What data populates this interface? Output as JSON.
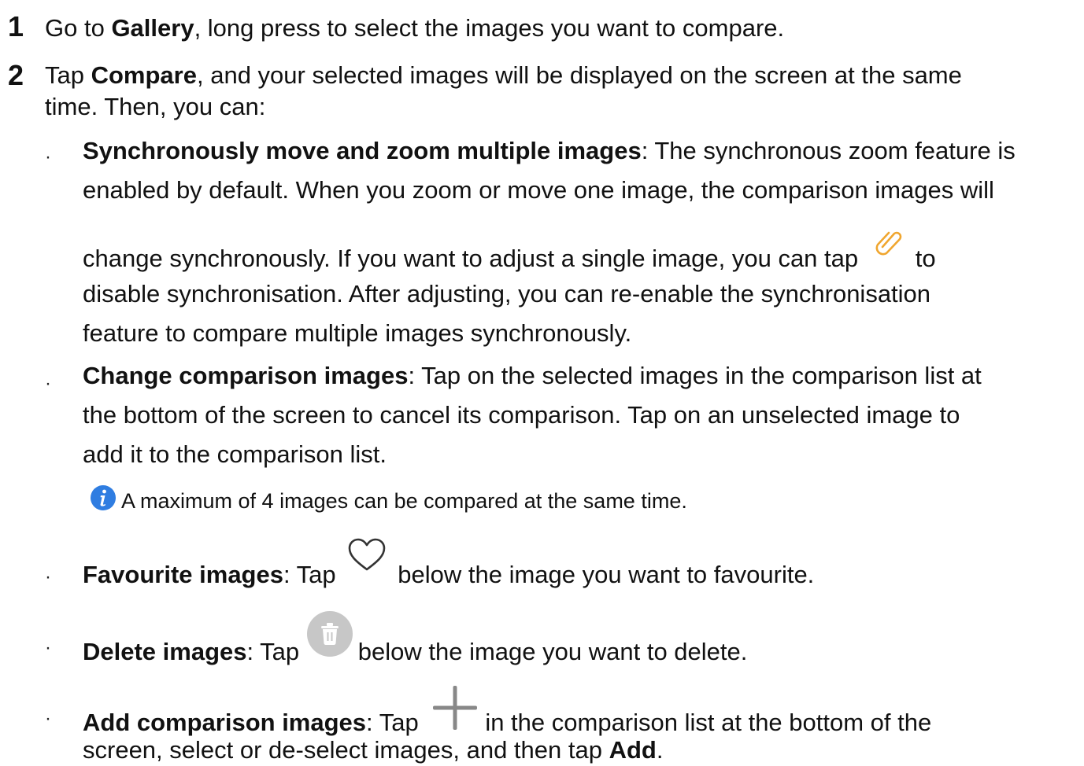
{
  "steps": [
    {
      "num": "1",
      "pre": "Go to ",
      "bold": "Gallery",
      "post": ", long press to select the images you want to compare."
    },
    {
      "num": "2",
      "pre": "Tap ",
      "bold": "Compare",
      "post": ", and your selected images will be displayed on the screen at the same",
      "line2": "time. Then, you can:"
    }
  ],
  "bullets": {
    "sync": {
      "title": "Synchronously move and zoom multiple images",
      "line1_rest": ": The synchronous zoom feature is",
      "line2": "enabled by default. When you zoom or move one image, the comparison images will",
      "line3_pre": "change synchronously. If you want to adjust a single image, you can tap",
      "line3_post": "to",
      "line4": "disable synchronisation. After adjusting, you can re-enable the synchronisation",
      "line5": "feature to compare multiple images synchronously.",
      "icon": "link-icon"
    },
    "change": {
      "title": "Change comparison images",
      "line1_rest": ": Tap on the selected images in the comparison list at",
      "line2": "the bottom of the screen to cancel its comparison. Tap on an unselected image to",
      "line3": "add it to the comparison list."
    },
    "note": {
      "text": "A maximum of 4 images can be compared at the same time.",
      "icon": "info-icon"
    },
    "favourite": {
      "title": "Favourite images",
      "pre": ": Tap",
      "post": "below the image you want to favourite.",
      "icon": "heart-icon"
    },
    "delete": {
      "title": "Delete images",
      "pre": ": Tap",
      "post": "below the image you want to delete.",
      "icon": "trash-icon"
    },
    "add": {
      "title": "Add comparison images",
      "pre": ": Tap",
      "post": "in the comparison list at the bottom of the",
      "line2_pre": "screen, select or de-select images, and then tap ",
      "line2_bold": "Add",
      "line2_post": ".",
      "icon": "plus-icon"
    }
  },
  "colors": {
    "text": "#111111",
    "link_icon": "#f0a62f",
    "info_icon": "#2f7de1",
    "trash_icon_bg": "#c7c7c7"
  }
}
